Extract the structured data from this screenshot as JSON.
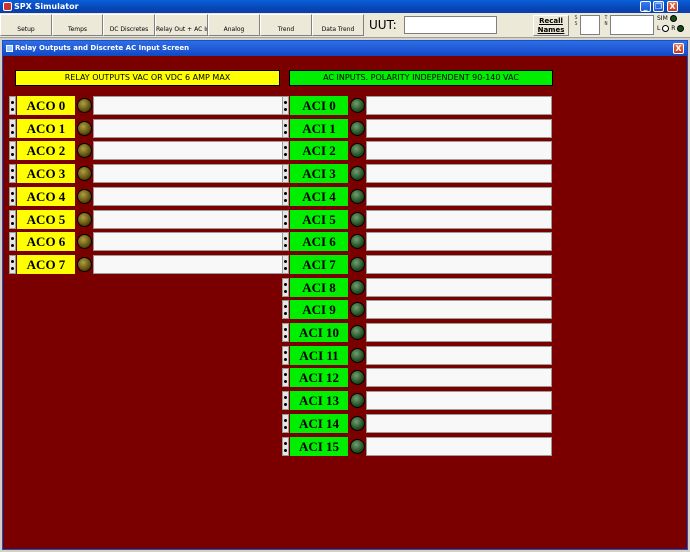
{
  "app": {
    "title": "SPX Simulator",
    "window_buttons": [
      "_",
      "❐",
      "X"
    ]
  },
  "toolbar": {
    "buttons": [
      "Setup",
      "Temps",
      "DC Discretes",
      "Relay Out + AC In",
      "Analog",
      "Trend",
      "Data Trend"
    ],
    "uut_label": "UUT:",
    "uut_value": "",
    "recall_line1": "Recall",
    "recall_line2": "Names",
    "mini1_label": "S\nS",
    "mini2_label": "T\nN",
    "sim_label": "SIM",
    "l_label": "L",
    "r_label": "R"
  },
  "window": {
    "title": "Relay Outputs and Discrete AC Input Screen",
    "close": "X"
  },
  "relay_header": "RELAY OUTPUTS VAC OR VDC 6 AMP MAX",
  "ac_header": "AC INPUTS.  POLARITY INDEPENDENT 90-140 VAC",
  "relay_outputs": [
    "ACO 0",
    "ACO 1",
    "ACO 2",
    "ACO 3",
    "ACO 4",
    "ACO 5",
    "ACO 6",
    "ACO 7"
  ],
  "ac_inputs": [
    "ACI 0",
    "ACI 1",
    "ACI 2",
    "ACI 3",
    "ACI 4",
    "ACI 5",
    "ACI 6",
    "ACI 7",
    "ACI 8",
    "ACI 9",
    "ACI 10",
    "ACI 11",
    "ACI 12",
    "ACI 13",
    "ACI 14",
    "ACI 15"
  ],
  "colors": {
    "background": "#7a0000",
    "relay": "#ffff00",
    "ac": "#00ee00"
  }
}
